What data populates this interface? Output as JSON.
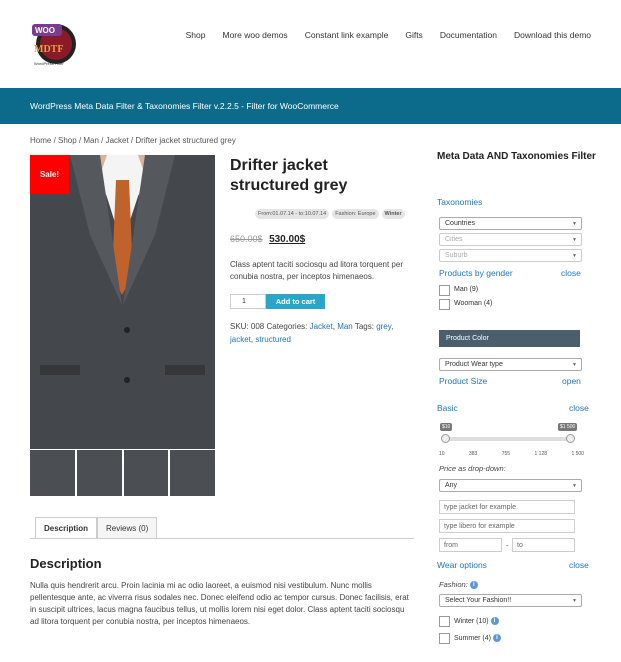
{
  "header": {
    "logo_text": "WOO MDTF",
    "logo_sub": "WordPress Filter",
    "nav": [
      "Shop",
      "More woo demos",
      "Constant link example",
      "Gifts",
      "Documentation",
      "Download this demo"
    ]
  },
  "banner": "WordPress Meta Data Filter & Taxonomies Filter v.2.2.5 - Filter for WooCommerce",
  "breadcrumb": "Home / Shop / Man / Jacket / Drifter jacket structured grey",
  "product": {
    "sale_badge": "Sale!",
    "title": "Drifter jacket structured grey",
    "tags": [
      "From:01.07.14 - to:10.07.14",
      "Fashion: Europe",
      "Winter"
    ],
    "old_price": "650.00$",
    "price": "530.00$",
    "short_desc": "Class aptent taciti sociosqu ad litora torquent per conubia nostra, per inceptos himenaeos.",
    "qty": "1",
    "add_to_cart": "Add to cart",
    "sku_label": "SKU: 008 Categories:",
    "cat1": "Jacket",
    "cat2": "Man",
    "tags_label": "Tags:",
    "tag1": "grey",
    "tag2": "jacket",
    "tag3": "structured"
  },
  "tabs": {
    "description": "Description",
    "reviews": "Reviews (0)"
  },
  "description": {
    "title": "Description",
    "text": "Nulla quis hendrerit arcu. Proin lacinia mi ac odio laoreet, a euismod nisi vestibulum. Nunc mollis pellentesque ante, ac viverra risus sodales nec. Donec eleifend odio ac tempor cursus. Donec facilisis, erat in suscipit ultrices, lacus magna faucibus tellus, ut mollis lorem nisi eget dolor. Class aptent taciti sociosqu ad litora torquent per conubia nostra, per inceptos himenaeos."
  },
  "sidebar": {
    "title": "Meta Data AND Taxonomies Filter",
    "taxonomies": "Taxonomies",
    "countries": "Countries",
    "cities": "Cities",
    "suburb": "Suburb",
    "products_by_gender": "Products by gender",
    "close": "close",
    "open": "open",
    "man": "Man (9)",
    "wooman": "Wooman (4)",
    "product_color": "Product Color",
    "product_wear_type": "Product Wear type",
    "product_size": "Product Size",
    "basic": "Basic",
    "slider_min": "$10",
    "slider_max": "$1 500",
    "ticks": [
      "10",
      "383",
      "755",
      "1 128",
      "1 500"
    ],
    "price_dropdown_label": "Price as drop-down:",
    "any": "Any",
    "ph1": "type jacket for example",
    "ph2": "type libero for example",
    "from": "from",
    "dash": "-",
    "to": "to",
    "wear_options": "Wear options",
    "fashion_label": "Fashion:",
    "fashion_select": "Select Your Fashion!!",
    "winter": "Winter (10)",
    "summer": "Summer (4)"
  }
}
